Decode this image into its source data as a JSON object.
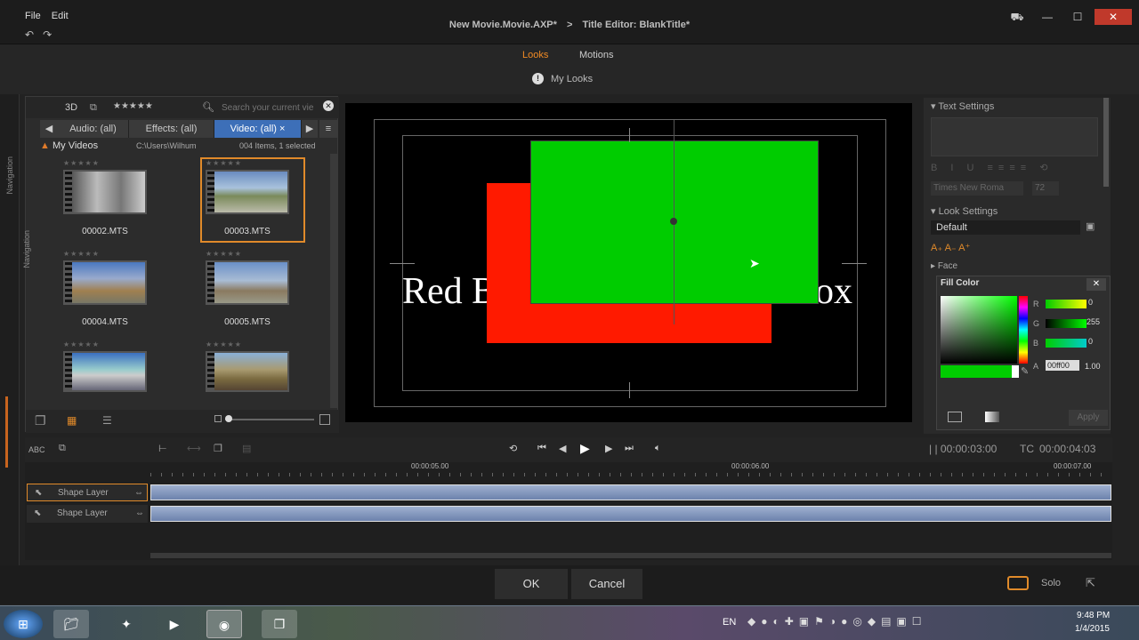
{
  "menu": {
    "file": "File",
    "edit": "Edit"
  },
  "document": {
    "project": "New Movie.Movie.AXP*",
    "separator": ">",
    "editor": "Title Editor: BlankTitle*"
  },
  "header": {
    "tab_looks": "Looks",
    "tab_motions": "Motions",
    "my_looks": "My Looks"
  },
  "sidenav": {
    "label_top": "Navigation",
    "label_side": "Navigation"
  },
  "library": {
    "mode_3d": "3D",
    "rating": "★★★★★",
    "search_placeholder": "Search your current vie",
    "tabs": [
      {
        "label": "Audio: (all)"
      },
      {
        "label": "Effects: (all)"
      },
      {
        "label": "Video: (all)"
      }
    ],
    "folder": "My Videos",
    "path": "C:\\Users\\Wilhum",
    "count": "004 Items, 1 selected",
    "items": [
      {
        "name": "00002.MTS"
      },
      {
        "name": "00003.MTS"
      },
      {
        "name": "00004.MTS"
      },
      {
        "name": "00005.MTS"
      },
      {
        "name": ""
      },
      {
        "name": ""
      }
    ]
  },
  "preview": {
    "title_text_left": "Red B",
    "title_text_right": "ox",
    "shape_colors": {
      "red": "#ff1a00",
      "green": "#00cc00"
    }
  },
  "right_panel": {
    "text_settings": "Text Settings",
    "font": "Times New Roma",
    "font_size": "72",
    "look_settings": "Look Settings",
    "look_name": "Default",
    "face": "Face",
    "fill_color_title": "Fill Color",
    "r_label": "R",
    "r_value": "0",
    "g_label": "G",
    "g_value": "255",
    "b_label": "B",
    "b_value": "0",
    "a_label": "A",
    "hex": "00ff00",
    "alpha": "1.00",
    "apply": "Apply"
  },
  "transport": {
    "abc": "ABC",
    "duration": "| | 00:00:03:00",
    "tc_label": "TC",
    "timecode": "00:00:04:03"
  },
  "timeline": {
    "ruler": [
      "00:00:05.00",
      "00:00:06.00",
      "00:00:07.00"
    ],
    "tracks": [
      {
        "label": "Shape Layer"
      },
      {
        "label": "Shape Layer"
      }
    ]
  },
  "footer": {
    "ok": "OK",
    "cancel": "Cancel",
    "solo": "Solo"
  },
  "taskbar": {
    "lang": "EN",
    "time": "9:48 PM",
    "date": "1/4/2015"
  }
}
